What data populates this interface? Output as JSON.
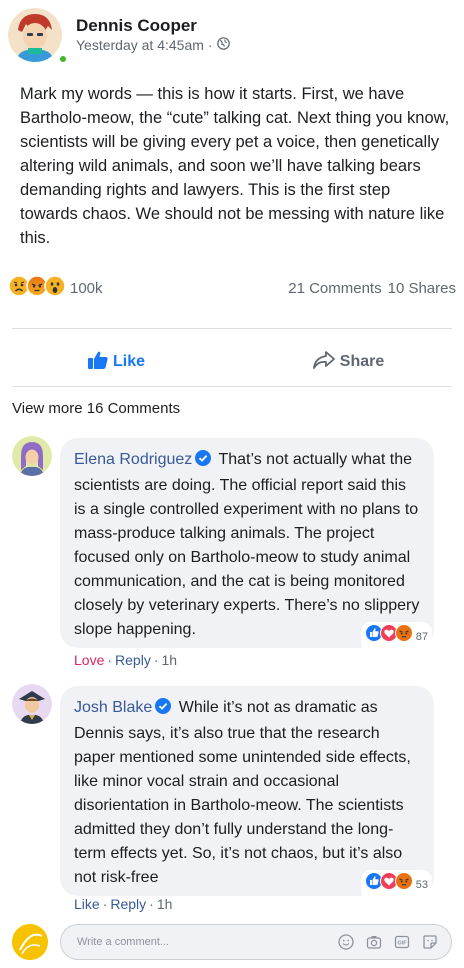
{
  "post": {
    "author": "Dennis Cooper",
    "timestamp": "Yesterday at 4:45am",
    "separator": "·",
    "audience_icon": "globe-icon",
    "body": "Mark my words — this is how it starts. First, we have Bartholo-meow, the “cute” talking cat. Next thing you know, scientists will be giving every pet a voice, then genetically altering wild animals, and soon we’ll have talking bears demanding rights and lawyers. This is the first step towards chaos. We should not be messing with nature like this.",
    "reaction_icons": [
      "sad-reaction-icon",
      "angry-reaction-icon",
      "wow-reaction-icon"
    ],
    "reaction_count": "100k",
    "comments_count": "21 Comments",
    "shares_count": "10 Shares"
  },
  "actions": {
    "like_label": "Like",
    "share_label": "Share"
  },
  "comments_section": {
    "view_more": "View more 16 Comments",
    "comments": [
      {
        "author": "Elena Rodriguez",
        "verified": true,
        "text": "That’s not actually what the scientists are doing. The official report said this is a single controlled experiment with no plans to mass-produce talking animals. The project focused only on Bartholo-meow to study animal communication, and the cat is being monitored closely by veterinary experts. There’s no slippery slope happening.",
        "reaction_icons": [
          "like-reaction-icon",
          "love-reaction-icon",
          "angry-reaction-icon"
        ],
        "reaction_count": "87",
        "action_primary": "Love",
        "action_reply": "Reply",
        "time": "1h"
      },
      {
        "author": "Josh Blake",
        "verified": true,
        "text": "While it’s not as dramatic as Dennis says, it’s also true that the research paper mentioned some unintended side effects, like minor vocal strain and occasional disorientation in Bartholo-meow. The scientists admitted they don’t fully understand the long-term effects yet. So, it’s not chaos, but it’s also not risk-free",
        "reaction_icons": [
          "like-reaction-icon",
          "love-reaction-icon",
          "angry-reaction-icon"
        ],
        "reaction_count": "53",
        "action_primary": "Like",
        "action_reply": "Reply",
        "time": "1h"
      }
    ]
  },
  "composer": {
    "placeholder": "Write a comment...",
    "icons": [
      "emoji-icon",
      "camera-icon",
      "gif-icon",
      "sticker-icon"
    ]
  },
  "colors": {
    "link_blue": "#385898",
    "like_blue": "#1877f2",
    "love_pink": "#e0245e",
    "meta_gray": "#606770",
    "bubble_bg": "#f0f2f5",
    "online_green": "#42b72a"
  }
}
